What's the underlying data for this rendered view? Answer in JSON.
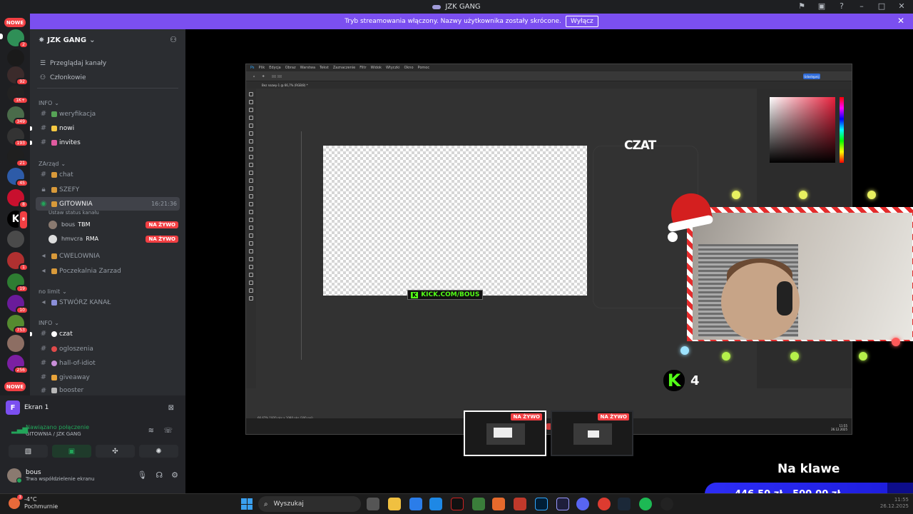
{
  "window": {
    "title": "JZK GANG"
  },
  "banner": {
    "text": "Tryb streamowania włączony. Nazwy użytkownika zostały skrócone.",
    "button": "Wyłącz"
  },
  "rail": {
    "top_badge": "NOWE",
    "bottom_badge": "NOWE",
    "badges": [
      "2",
      "92",
      "1K+",
      "349",
      "193",
      "21",
      "45",
      "8",
      "8",
      "1",
      "19",
      "10",
      "753",
      "256"
    ]
  },
  "guild": {
    "name": "JZK GANG"
  },
  "nav": {
    "browse": "Przeglądaj kanały",
    "members": "Członkowie"
  },
  "categories": {
    "info": "INFO",
    "zarzad": "ZArząd",
    "nolimit": "no limit",
    "info2": "INFO"
  },
  "channels": {
    "weryfikacja": "weryfikacja",
    "nowi": "nowi",
    "invites": "invites",
    "chat": "chat",
    "szefy": "SZEFY",
    "gitownia": "GITOWNIA",
    "gitownia_time": "16:21:36",
    "status_hint": "Ustaw status kanału",
    "cwelownia": "CWELOWNIA",
    "poczekalnia": "Poczekalnia Zarzad",
    "stworz": "STWÓRZ KANAŁ",
    "czat": "czat",
    "ogloszenia": "ogloszenia",
    "hall": "hall-of-idiot",
    "giveaway": "giveaway",
    "booster": "booster"
  },
  "voice_users": [
    {
      "name": "bous",
      "tag": "TBM",
      "live": "NA ŻYWO"
    },
    {
      "name": "hmvcra",
      "tag": "RMA",
      "live": "NA ŻYWO"
    }
  ],
  "panel": {
    "screen": "Ekran 1",
    "status": "Nawiązano połączenie",
    "location": "GITOWNIA / JZK GANG",
    "user": "bous",
    "user_status": "Trwa współdzielenie ekranu"
  },
  "photoshop": {
    "menu": [
      "Plik",
      "Edycja",
      "Obraz",
      "Warstwa",
      "Tekst",
      "Zaznaczenie",
      "Filtr",
      "Widok",
      "Wtyczki",
      "Okno",
      "Pomoc"
    ],
    "tab": "Bez nazwy-1 @ 66,7% (RGB/8) *",
    "share": "Udostępnij",
    "status": "66,67%  1920 pks x 1080 pks (300 ppi)",
    "kick_text": "KICK.COM/BOUS",
    "czat": "CZAT",
    "clock": "11:55",
    "date": "26.12.2025"
  },
  "overlay": {
    "kick_count": "4",
    "goal_label": "Na klawe",
    "goal_current": "446,50 zł",
    "goal_target": "500,00 zł"
  },
  "thumbs": [
    {
      "live": "NA ŻYWO"
    },
    {
      "live": "NA ŻYWO"
    }
  ],
  "taskbar": {
    "temp": "-4°C",
    "weather": "Pochmurnie",
    "search": "Wyszukaj",
    "time": "11:55",
    "date": "26.12.2025"
  },
  "colors": {
    "accent": "#7b4ff0",
    "live_red": "#f23f43",
    "kick_green": "#53fc18"
  }
}
